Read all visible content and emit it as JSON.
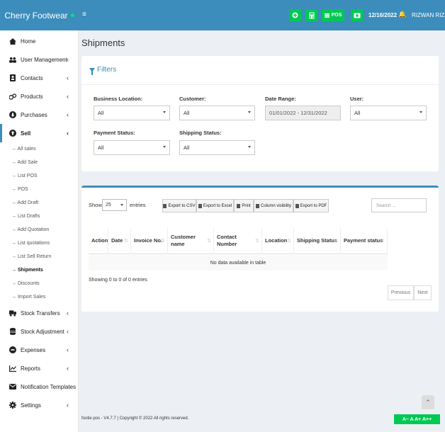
{
  "brand": {
    "name": "Cherry Footwear"
  },
  "header": {
    "menu_icon": "≡",
    "pos_label": "POS",
    "date": "12/16/2022",
    "user": "RIZWAN RIZ"
  },
  "sidebar": {
    "items": [
      {
        "label": "Home",
        "icon": "home-icon"
      },
      {
        "label": "User Management",
        "icon": "users-icon"
      },
      {
        "label": "Contacts",
        "icon": "contacts-icon"
      },
      {
        "label": "Products",
        "icon": "products-icon"
      },
      {
        "label": "Purchases",
        "icon": "purchases-icon"
      },
      {
        "label": "Sell",
        "icon": "sell-icon"
      }
    ],
    "sell_sub": [
      "→ All sales",
      "→ Add Sale",
      "→ List POS",
      "→ POS",
      "→ Add Draft",
      "→ List Drafts",
      "→ Add Quotation",
      "→ List quotations",
      "→ List Sell Return",
      "→ Shipments",
      "→ Discounts",
      "→ Import Sales"
    ],
    "items_after": [
      {
        "label": "Stock Transfers",
        "icon": "truck-icon"
      },
      {
        "label": "Stock Adjustment",
        "icon": "database-icon"
      },
      {
        "label": "Expenses",
        "icon": "minus-circle-icon"
      },
      {
        "label": "Reports",
        "icon": "chart-icon"
      },
      {
        "label": "Notification Templates",
        "icon": "envelope-icon"
      },
      {
        "label": "Settings",
        "icon": "gear-icon"
      }
    ]
  },
  "page": {
    "title": "Shipments"
  },
  "filters": {
    "title": "Filters",
    "business_location": {
      "label": "Business Location:",
      "value": "All"
    },
    "customer": {
      "label": "Customer:",
      "value": "All"
    },
    "date_range": {
      "label": "Date Range:",
      "value": "01/01/2022 - 12/31/2022"
    },
    "user": {
      "label": "User:",
      "value": "All"
    },
    "payment_status": {
      "label": "Payment Status:",
      "value": "All"
    },
    "shipping_status": {
      "label": "Shipping Status:",
      "value": "All"
    }
  },
  "table": {
    "show_label": "Show",
    "length_value": "25",
    "entries_label": "entries",
    "buttons": [
      "Export to CSV",
      "Export to Excel",
      "Print",
      "Column visibility",
      "Export to PDF"
    ],
    "search_placeholder": "Search ...",
    "columns": [
      "Action",
      "Date",
      "Invoice No.",
      "Customer name",
      "Contact Number",
      "Location",
      "Shipping Status",
      "Payment status"
    ],
    "empty_message": "No data available in table",
    "info": "Showing 0 to 0 of 0 entries",
    "previous": "Previous",
    "next": "Next"
  },
  "footer": {
    "text": "footie pos - V4.7.7 | Copyright © 2022 All rights reserved.",
    "font_controls": "A− A A+ A++"
  },
  "colors": {
    "primary": "#3c8dbc",
    "accent_green": "#00c853"
  }
}
